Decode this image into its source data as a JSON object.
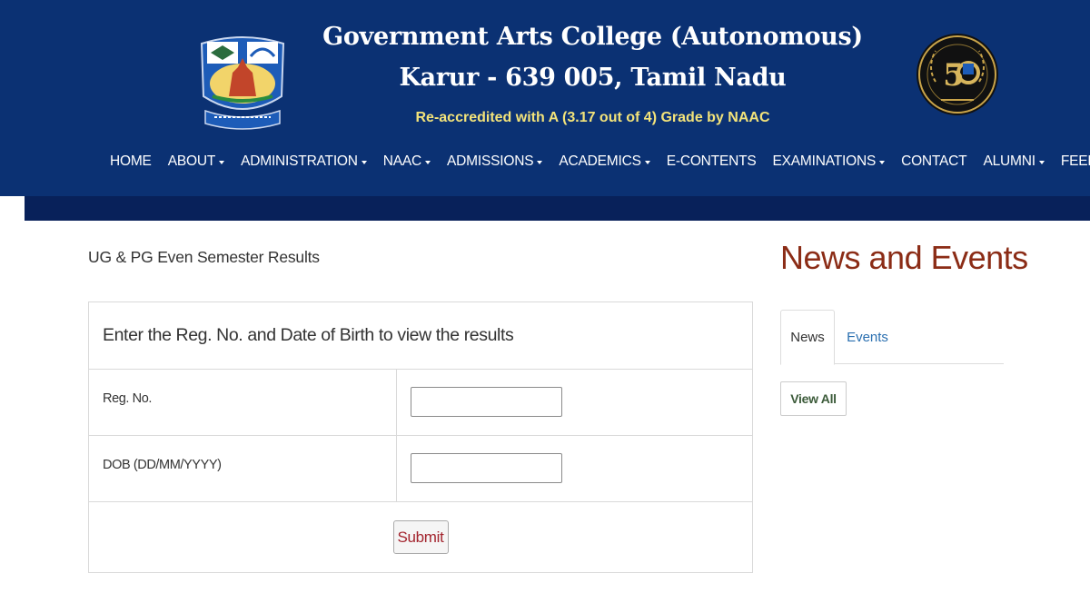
{
  "header": {
    "title_line1": "Government Arts College (Autonomous)",
    "title_line2": "Karur - 639 005, Tamil Nadu",
    "accreditation": "Re-accredited with A (3.17 out of 4) Grade by NAAC",
    "logo_left": "college-crest-icon",
    "logo_right": "golden-jubilee-emblem-icon",
    "colors": {
      "background": "#0b3173",
      "bar": "#08215a",
      "accreditation_text": "#f3e37a"
    }
  },
  "nav": {
    "items": [
      {
        "label": "HOME",
        "dropdown": false
      },
      {
        "label": "ABOUT",
        "dropdown": true
      },
      {
        "label": "ADMINISTRATION",
        "dropdown": true
      },
      {
        "label": "NAAC",
        "dropdown": true
      },
      {
        "label": "ADMISSIONS",
        "dropdown": true
      },
      {
        "label": "ACADEMICS",
        "dropdown": true
      },
      {
        "label": "E-CONTENTS",
        "dropdown": false
      },
      {
        "label": "EXAMINATIONS",
        "dropdown": true
      },
      {
        "label": "CONTACT",
        "dropdown": false
      },
      {
        "label": "ALUMNI",
        "dropdown": true
      },
      {
        "label": "FEEDBACK",
        "dropdown": false
      }
    ]
  },
  "main": {
    "page_heading": "UG & PG Even Semester Results",
    "form": {
      "instruction": "Enter the Reg. No. and Date of Birth to view the results",
      "reg_no_label": "Reg. No.",
      "reg_no_value": "",
      "dob_label": "DOB (DD/MM/YYYY)",
      "dob_value": "",
      "submit_label": "Submit"
    }
  },
  "sidebar": {
    "heading": "News and Events",
    "tabs": [
      {
        "label": "News",
        "active": true
      },
      {
        "label": "Events",
        "active": false
      }
    ],
    "view_all_label": "View All",
    "colors": {
      "heading": "#8b2c16",
      "link": "#2a6fb0"
    }
  }
}
